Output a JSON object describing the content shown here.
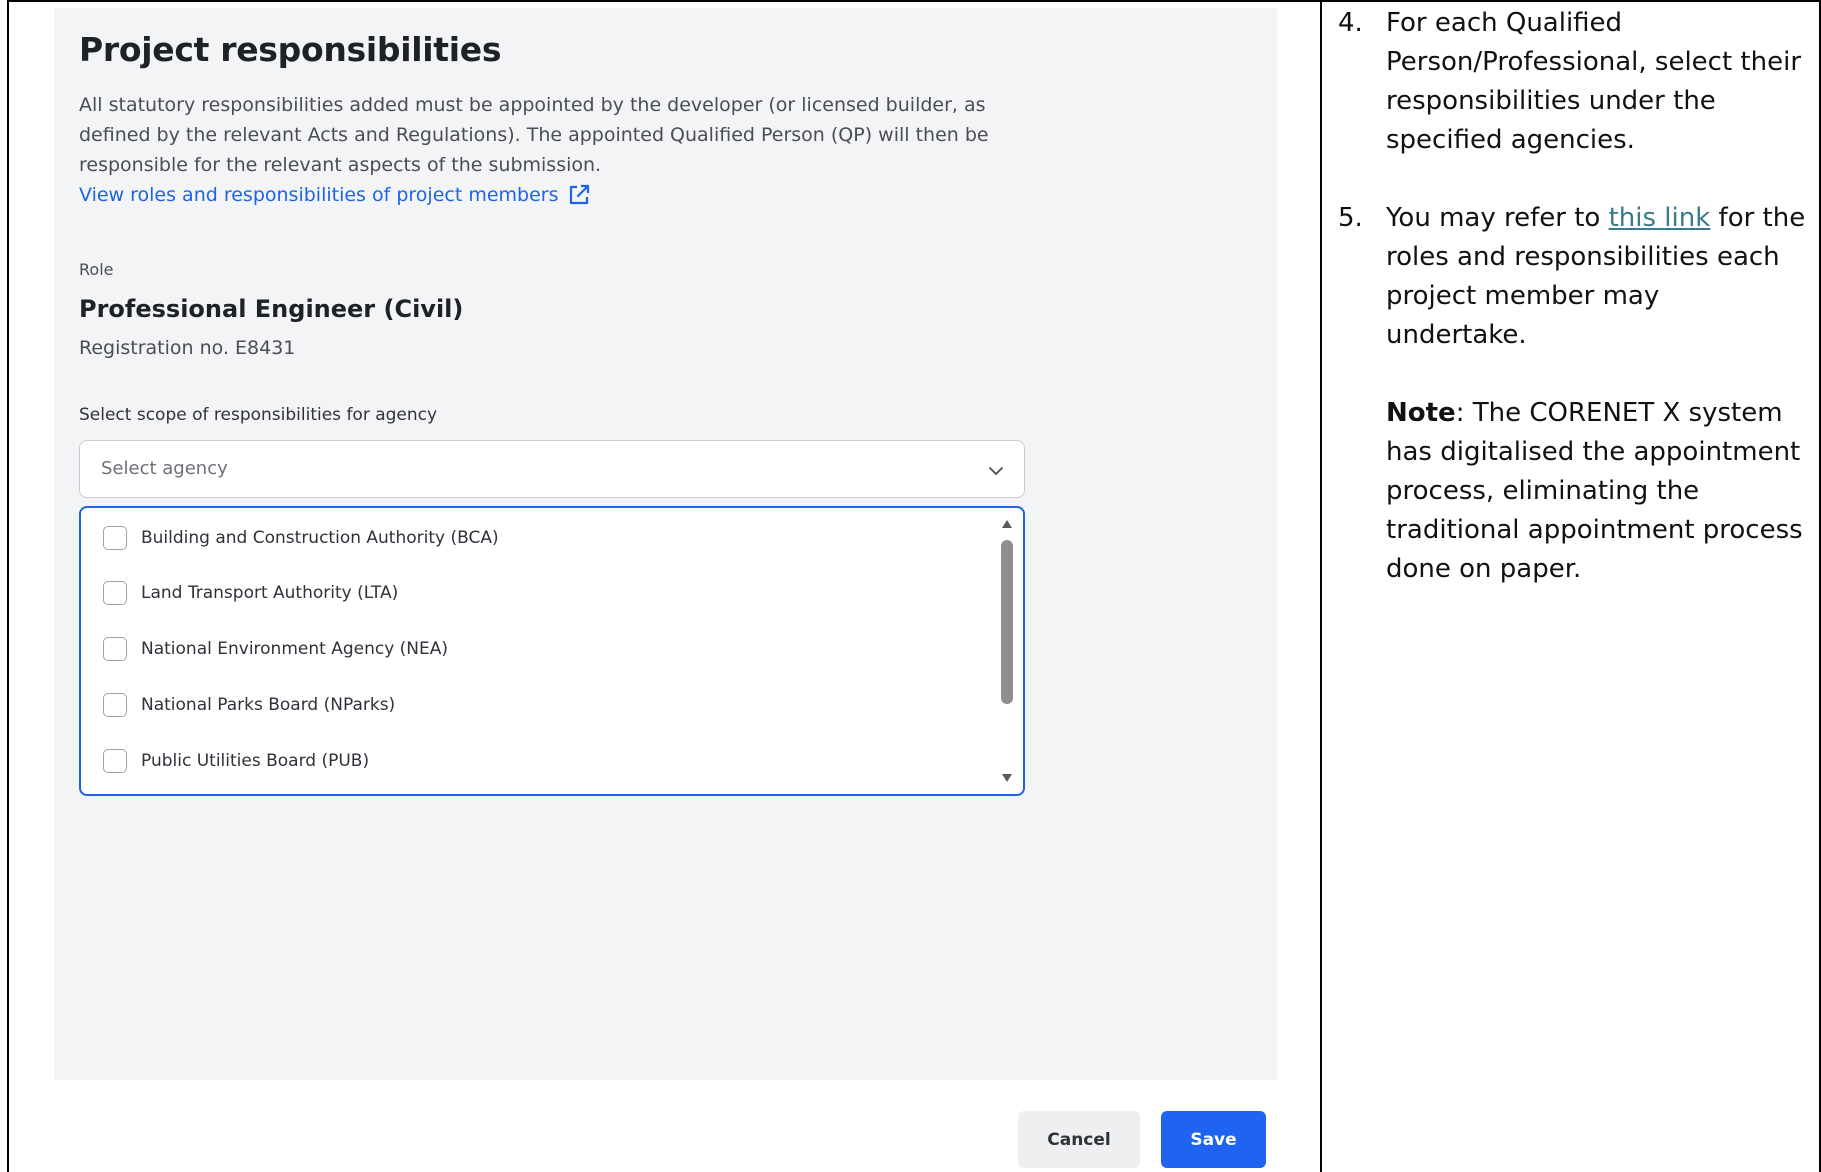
{
  "panel": {
    "title": "Project responsibilities",
    "description": "All statutory responsibilities added must be appointed by the developer (or licensed builder, as defined by the relevant Acts and Regulations). The appointed Qualified Person (QP) will then be responsible for the relevant aspects of the submission.",
    "view_link": "View roles and responsibilities of project members",
    "role_label": "Role",
    "role_name": "Professional Engineer (Civil)",
    "registration": "Registration no. E8431",
    "scope_label": "Select scope of responsibilities for agency",
    "select_placeholder": "Select agency",
    "agencies": [
      "Building and Construction Authority (BCA)",
      "Land Transport Authority (LTA)",
      "National Environment Agency (NEA)",
      "National Parks Board (NParks)",
      "Public Utilities Board (PUB)"
    ],
    "cancel_label": "Cancel",
    "save_label": "Save"
  },
  "instructions": {
    "step4_num": "4.",
    "step4_text": "For each Qualified Person/Professional, select their responsibilities under the specified agencies.",
    "step5_num": "5.",
    "step5_pre": "You may refer to ",
    "step5_link": "this link",
    "step5_post": " for the roles and responsibilities each project member may undertake.",
    "note_label": "Note",
    "note_text": ": The CORENET X system has digitalised the appointment process, eliminating the traditional appointment process done on paper."
  },
  "colors": {
    "accent": "#1f64e5",
    "save_bg": "#1f64f0",
    "panel_bg": "#f3f4f6",
    "doc_link": "#3b7a8a"
  }
}
